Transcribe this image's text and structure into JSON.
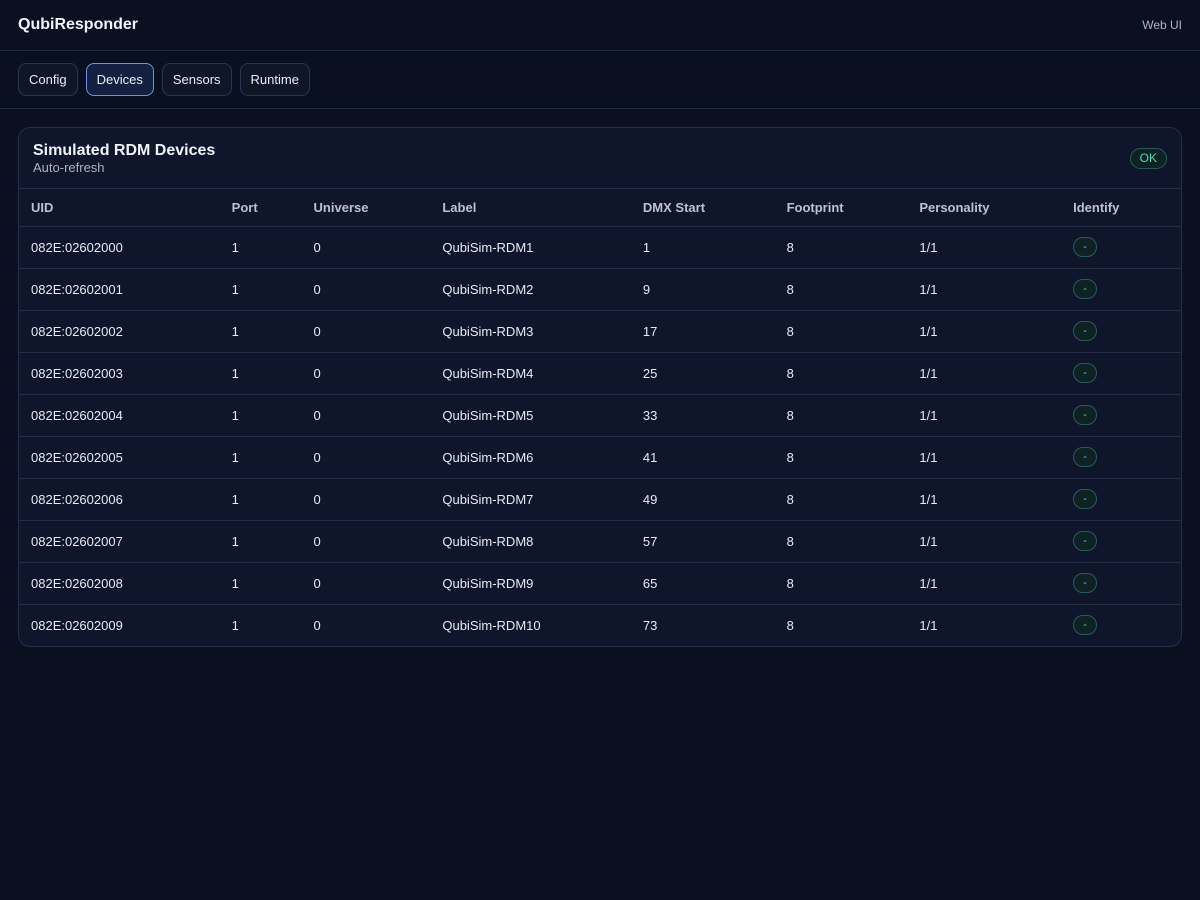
{
  "app": {
    "title": "QubiResponder",
    "subtitle": "Web UI"
  },
  "tabs": [
    {
      "label": "Config",
      "active": false
    },
    {
      "label": "Devices",
      "active": true
    },
    {
      "label": "Sensors",
      "active": false
    },
    {
      "label": "Runtime",
      "active": false
    }
  ],
  "card": {
    "title": "Simulated RDM Devices",
    "subtitle": "Auto-refresh",
    "status": "OK"
  },
  "table": {
    "columns": [
      "UID",
      "Port",
      "Universe",
      "Label",
      "DMX Start",
      "Footprint",
      "Personality",
      "Identify"
    ],
    "rows": [
      {
        "uid": "082E:02602000",
        "port": "1",
        "universe": "0",
        "label": "QubiSim-RDM1",
        "dmx_start": "1",
        "footprint": "8",
        "personality": "1/1",
        "identify": "-"
      },
      {
        "uid": "082E:02602001",
        "port": "1",
        "universe": "0",
        "label": "QubiSim-RDM2",
        "dmx_start": "9",
        "footprint": "8",
        "personality": "1/1",
        "identify": "-"
      },
      {
        "uid": "082E:02602002",
        "port": "1",
        "universe": "0",
        "label": "QubiSim-RDM3",
        "dmx_start": "17",
        "footprint": "8",
        "personality": "1/1",
        "identify": "-"
      },
      {
        "uid": "082E:02602003",
        "port": "1",
        "universe": "0",
        "label": "QubiSim-RDM4",
        "dmx_start": "25",
        "footprint": "8",
        "personality": "1/1",
        "identify": "-"
      },
      {
        "uid": "082E:02602004",
        "port": "1",
        "universe": "0",
        "label": "QubiSim-RDM5",
        "dmx_start": "33",
        "footprint": "8",
        "personality": "1/1",
        "identify": "-"
      },
      {
        "uid": "082E:02602005",
        "port": "1",
        "universe": "0",
        "label": "QubiSim-RDM6",
        "dmx_start": "41",
        "footprint": "8",
        "personality": "1/1",
        "identify": "-"
      },
      {
        "uid": "082E:02602006",
        "port": "1",
        "universe": "0",
        "label": "QubiSim-RDM7",
        "dmx_start": "49",
        "footprint": "8",
        "personality": "1/1",
        "identify": "-"
      },
      {
        "uid": "082E:02602007",
        "port": "1",
        "universe": "0",
        "label": "QubiSim-RDM8",
        "dmx_start": "57",
        "footprint": "8",
        "personality": "1/1",
        "identify": "-"
      },
      {
        "uid": "082E:02602008",
        "port": "1",
        "universe": "0",
        "label": "QubiSim-RDM9",
        "dmx_start": "65",
        "footprint": "8",
        "personality": "1/1",
        "identify": "-"
      },
      {
        "uid": "082E:02602009",
        "port": "1",
        "universe": "0",
        "label": "QubiSim-RDM10",
        "dmx_start": "73",
        "footprint": "8",
        "personality": "1/1",
        "identify": "-"
      }
    ]
  },
  "colors": {
    "background": "#0b1020",
    "card": "#0f162b",
    "accent_ok": "#58d4bc",
    "active_tab_border": "#6b94e0"
  }
}
